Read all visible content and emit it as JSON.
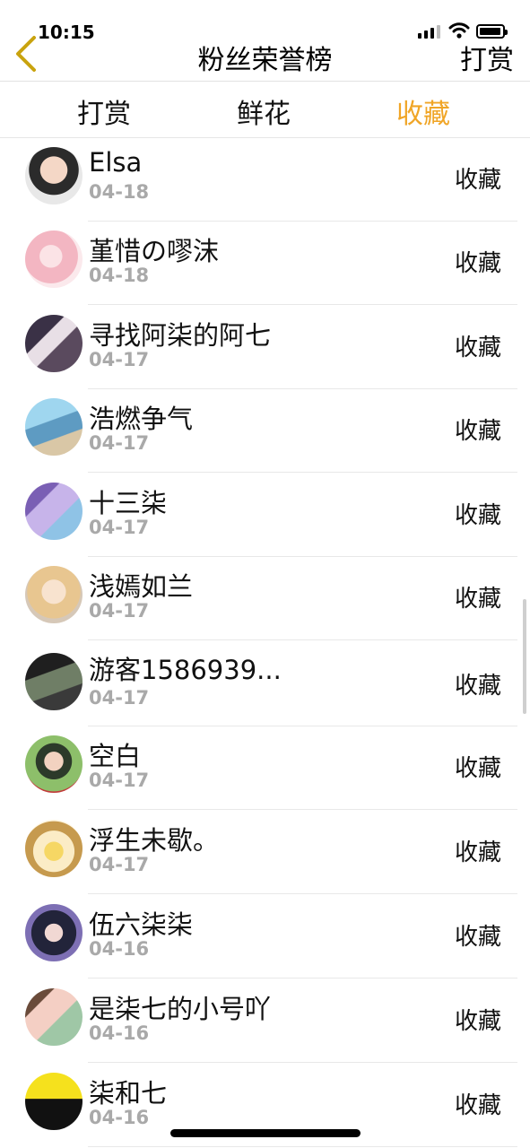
{
  "status_bar": {
    "time": "10:15"
  },
  "nav": {
    "title": "粉丝荣誉榜",
    "right_label": "打赏"
  },
  "tabs": [
    {
      "label": "打赏",
      "active": false
    },
    {
      "label": "鲜花",
      "active": false
    },
    {
      "label": "收藏",
      "active": true
    }
  ],
  "colors": {
    "accent": "#f0a526",
    "date_gray": "#a9a9a9",
    "divider": "#e8e8e8"
  },
  "fans": [
    {
      "name": "Elsa",
      "date": "04-18",
      "action": "收藏"
    },
    {
      "name": "堇惜の嘐沫",
      "date": "04-18",
      "action": "收藏"
    },
    {
      "name": "寻找阿柒的阿七",
      "date": "04-17",
      "action": "收藏"
    },
    {
      "name": "浩燃争气",
      "date": "04-17",
      "action": "收藏"
    },
    {
      "name": "十三柒",
      "date": "04-17",
      "action": "收藏"
    },
    {
      "name": "浅嫣如兰",
      "date": "04-17",
      "action": "收藏"
    },
    {
      "name": "游客1586939...",
      "date": "04-17",
      "action": "收藏"
    },
    {
      "name": "空白",
      "date": "04-17",
      "action": "收藏"
    },
    {
      "name": "浮生未歇。",
      "date": "04-17",
      "action": "收藏"
    },
    {
      "name": "伍六柒柒",
      "date": "04-16",
      "action": "收藏"
    },
    {
      "name": "是柒七的小号吖",
      "date": "04-16",
      "action": "收藏"
    },
    {
      "name": "柒和七",
      "date": "04-16",
      "action": "收藏"
    }
  ]
}
